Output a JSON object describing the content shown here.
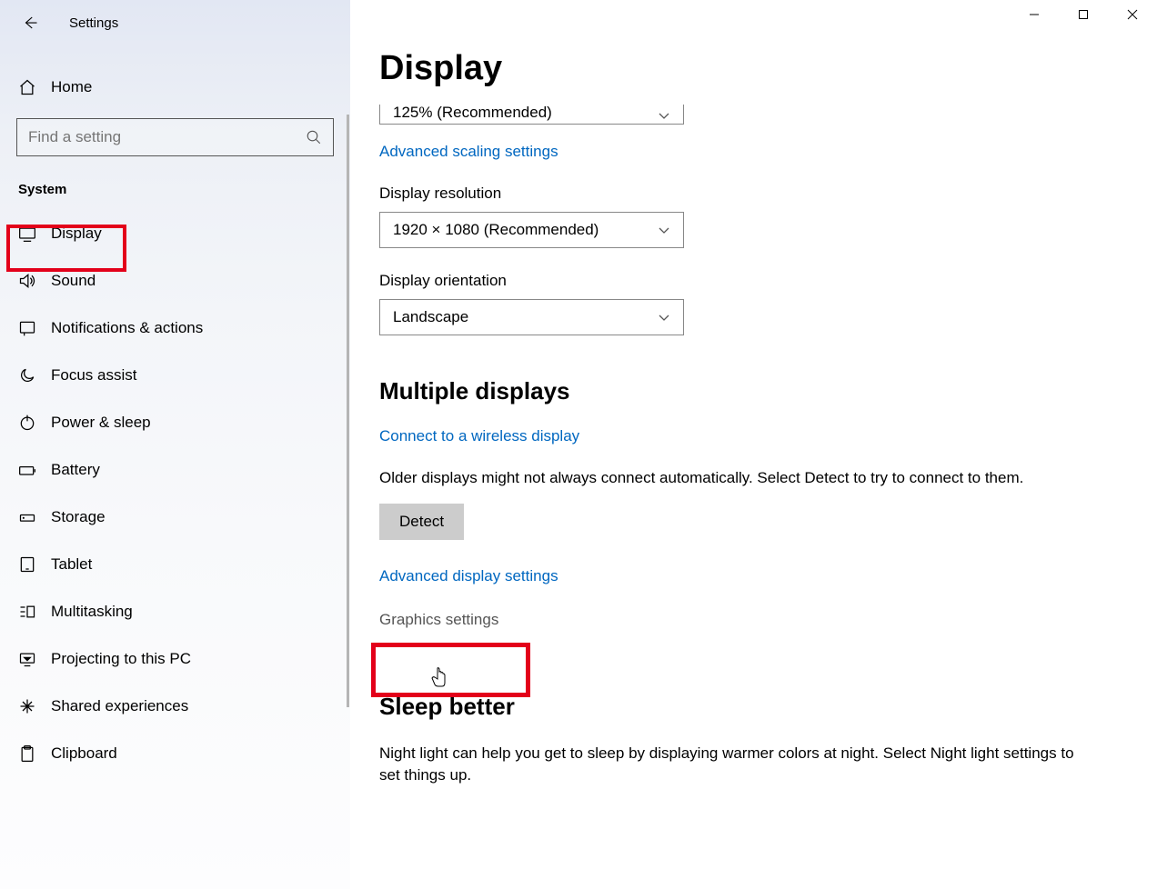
{
  "app_title": "Settings",
  "home_label": "Home",
  "search_placeholder": "Find a setting",
  "sidebar_section": "System",
  "nav": [
    {
      "label": "Display"
    },
    {
      "label": "Sound"
    },
    {
      "label": "Notifications & actions"
    },
    {
      "label": "Focus assist"
    },
    {
      "label": "Power & sleep"
    },
    {
      "label": "Battery"
    },
    {
      "label": "Storage"
    },
    {
      "label": "Tablet"
    },
    {
      "label": "Multitasking"
    },
    {
      "label": "Projecting to this PC"
    },
    {
      "label": "Shared experiences"
    },
    {
      "label": "Clipboard"
    }
  ],
  "page_title": "Display",
  "scale_value": "125% (Recommended)",
  "link_adv_scaling": "Advanced scaling settings",
  "label_resolution": "Display resolution",
  "value_resolution": "1920 × 1080 (Recommended)",
  "label_orientation": "Display orientation",
  "value_orientation": "Landscape",
  "section_multi": "Multiple displays",
  "link_wireless": "Connect to a wireless display",
  "multi_body": "Older displays might not always connect automatically. Select Detect to try to connect to them.",
  "btn_detect": "Detect",
  "link_adv_display": "Advanced display settings",
  "link_graphics": "Graphics settings",
  "section_sleep": "Sleep better",
  "sleep_body": "Night light can help you get to sleep by displaying warmer colors at night. Select Night light settings to set things up."
}
